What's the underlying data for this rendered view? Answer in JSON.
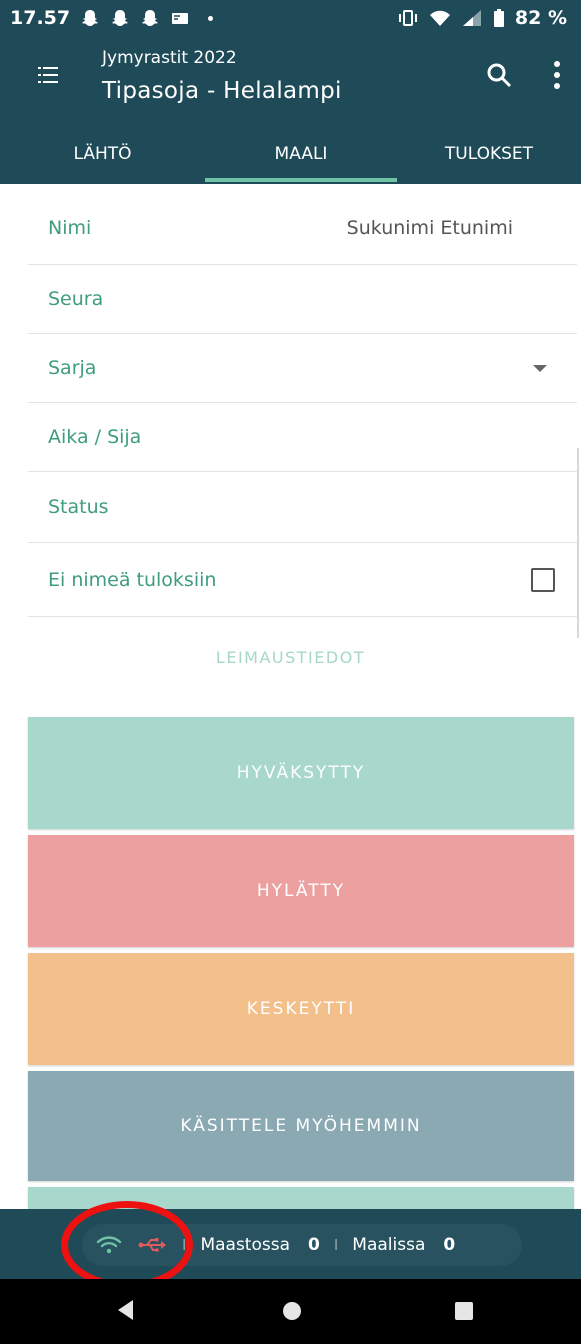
{
  "status_bar": {
    "time": "17.57",
    "battery": "82 %"
  },
  "app_bar": {
    "subtitle": "Jymyrastit 2022",
    "title": "Tipasoja - Helalampi"
  },
  "tabs": [
    {
      "label": "LÄHTÖ",
      "active": false
    },
    {
      "label": "MAALI",
      "active": true
    },
    {
      "label": "TULOKSET",
      "active": false
    }
  ],
  "form": {
    "name_label": "Nimi",
    "name_value": "Sukunimi Etunimi",
    "club_label": "Seura",
    "class_label": "Sarja",
    "time_label": "Aika / Sija",
    "status_label": "Status",
    "hide_name_label": "Ei nimeä tuloksiin",
    "hide_name_checked": false
  },
  "stamp_link": "LEIMAUSTIEDOT",
  "actions": {
    "accepted": "HYVÄKSYTTY",
    "rejected": "HYLÄTTY",
    "dnf": "KESKEYTTI",
    "later": "KÄSITTELE MYÖHEMMIN"
  },
  "bottom_status": {
    "in_forest_label": "Maastossa",
    "in_forest_count": "0",
    "finished_label": "Maalissa",
    "finished_count": "0",
    "separator": "I"
  },
  "colors": {
    "primary": "#1f4a58",
    "accent": "#6fc2a5",
    "accepted": "#a8d8cb",
    "rejected": "#eca1a0",
    "dnf": "#f3bf8a",
    "later": "#8aa9b2"
  }
}
